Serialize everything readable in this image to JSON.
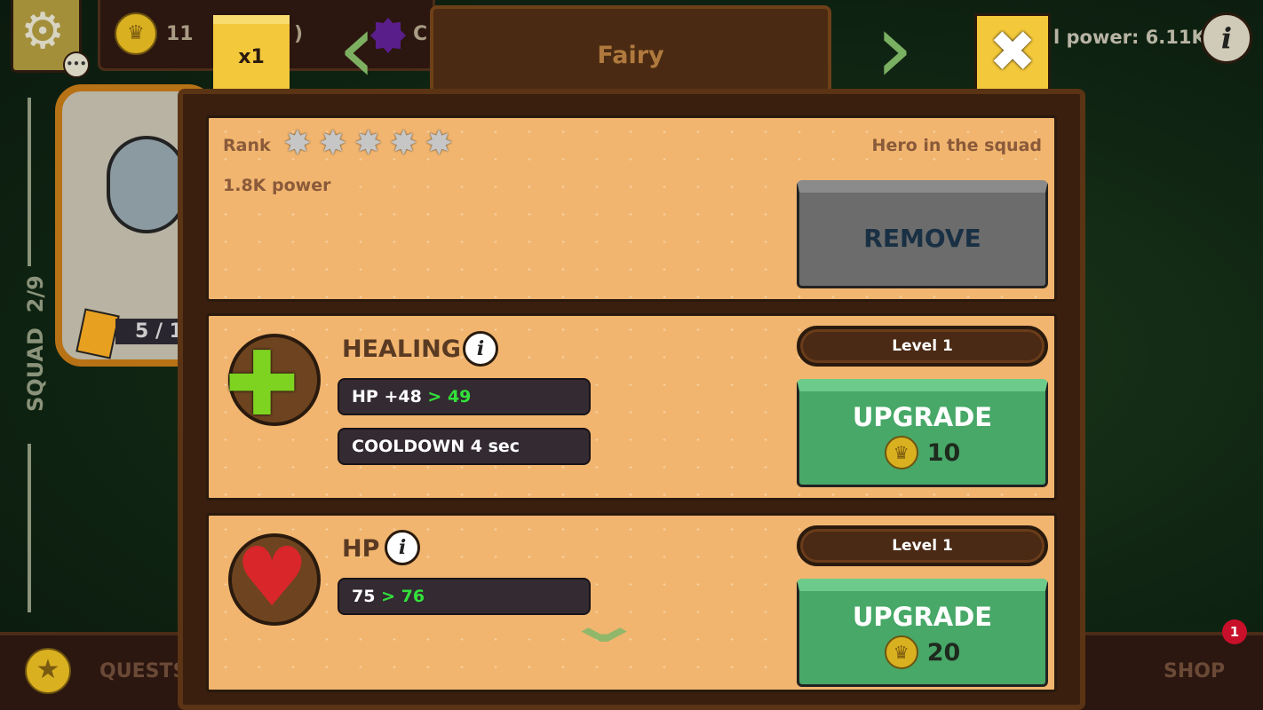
{
  "top_bar": {
    "gear_icon": "gear-icon",
    "more_icon": "ellipsis-icon",
    "crown_coins": "11",
    "second_currency": ")",
    "gem_currency": "C",
    "multiplier": "x1",
    "title": "Fairy",
    "total_power": "l power: 6.11K",
    "info_label": "i"
  },
  "left": {
    "squad_label": "SQUAD",
    "squad_count": "2/9",
    "hero_cards": "5 / 1"
  },
  "bottom": {
    "quests": "QUESTS",
    "shop": "SHOP",
    "shop_badge": "1"
  },
  "rank": {
    "label": "Rank",
    "stars": 5,
    "power": "1.8K power",
    "status": "Hero in the squad",
    "remove_label": "REMOVE"
  },
  "skills": [
    {
      "name": "HEALING",
      "info": "i",
      "stats": [
        {
          "base": "HP +48",
          "next": " > 49"
        },
        {
          "base": "COOLDOWN 4 sec",
          "next": ""
        }
      ],
      "level": "Level 1",
      "upgrade_label": "UPGRADE",
      "cost": "10",
      "icon": "green-cross-icon"
    },
    {
      "name": "HP",
      "info": "i",
      "stats": [
        {
          "base": "75",
          "next": " > 76"
        }
      ],
      "level": "Level 1",
      "upgrade_label": "UPGRADE",
      "cost": "20",
      "icon": "heart-icon"
    }
  ],
  "colors": {
    "sand": "#f1b56f",
    "upgrade": "#48a868",
    "remove": "#6c6c6c",
    "highlight": "#33e13a",
    "yellow": "#f3c83a"
  }
}
